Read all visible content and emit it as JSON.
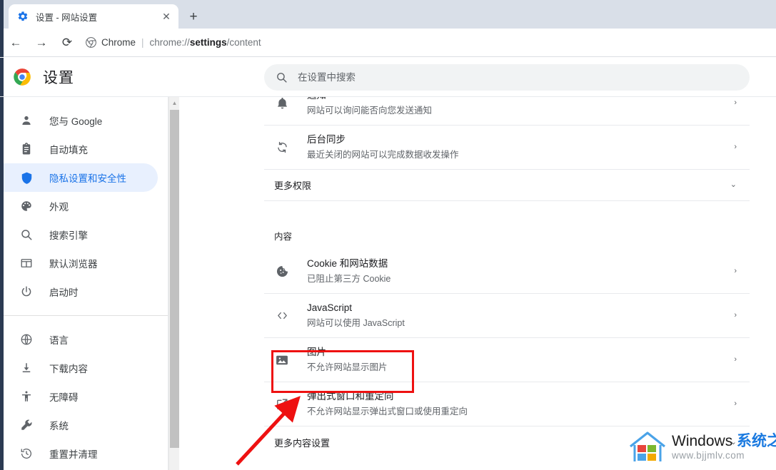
{
  "window": {
    "tab": {
      "title": "设置 - 网站设置",
      "favicon": "gear-icon",
      "close_label": "✕"
    },
    "new_tab_label": "+"
  },
  "toolbar": {
    "back_label": "←",
    "forward_label": "→",
    "reload_label": "⟳",
    "omnibox": {
      "scheme_label": "Chrome",
      "separator": "|",
      "url_prefix": "chrome://",
      "url_highlight": "settings",
      "url_suffix": "/content",
      "full_url": "chrome://settings/content"
    }
  },
  "settings_header": {
    "title": "设置",
    "search": {
      "placeholder": "在设置中搜索",
      "value": ""
    }
  },
  "sidebar": {
    "group1": [
      {
        "icon": "person-icon",
        "label": "您与 Google",
        "active": false
      },
      {
        "icon": "autofill-icon",
        "label": "自动填充",
        "active": false
      },
      {
        "icon": "shield-icon",
        "label": "隐私设置和安全性",
        "active": true
      },
      {
        "icon": "palette-icon",
        "label": "外观",
        "active": false
      },
      {
        "icon": "search-icon",
        "label": "搜索引擎",
        "active": false
      },
      {
        "icon": "browser-icon",
        "label": "默认浏览器",
        "active": false
      },
      {
        "icon": "power-icon",
        "label": "启动时",
        "active": false
      }
    ],
    "group2": [
      {
        "icon": "globe-icon",
        "label": "语言",
        "active": false
      },
      {
        "icon": "download-icon",
        "label": "下载内容",
        "active": false
      },
      {
        "icon": "accessibility-icon",
        "label": "无障碍",
        "active": false
      },
      {
        "icon": "wrench-icon",
        "label": "系统",
        "active": false
      },
      {
        "icon": "restore-icon",
        "label": "重置并清理",
        "active": false
      }
    ]
  },
  "main": {
    "permission_rows": [
      {
        "icon": "bell-icon",
        "title": "通知",
        "subtitle": "网站可以询问能否向您发送通知",
        "chevron": "›"
      },
      {
        "icon": "sync-icon",
        "title": "后台同步",
        "subtitle": "最近关闭的网站可以完成数据收发操作",
        "chevron": "›"
      }
    ],
    "more_permissions": {
      "label": "更多权限",
      "chevron": "⌄"
    },
    "content_section_label": "内容",
    "content_rows": [
      {
        "icon": "cookie-icon",
        "title": "Cookie 和网站数据",
        "subtitle": "已阻止第三方 Cookie",
        "chevron": "›",
        "highlighted": false
      },
      {
        "icon": "code-icon",
        "title": "JavaScript",
        "subtitle": "网站可以使用 JavaScript",
        "chevron": "›",
        "highlighted": false
      },
      {
        "icon": "image-icon",
        "title": "图片",
        "subtitle": "不允许网站显示图片",
        "chevron": "›",
        "highlighted": true
      },
      {
        "icon": "popup-icon",
        "title": "弹出式窗口和重定向",
        "subtitle": "不允许网站显示弹出式窗口或使用重定向",
        "chevron": "›",
        "highlighted": false
      }
    ],
    "more_content_settings": {
      "label": "更多内容设置",
      "chevron": "⌄"
    }
  },
  "annotations": {
    "highlight_color": "#ee1111",
    "box_target": "图片",
    "arrow_target": "弹出式窗口和重定向"
  },
  "watermark": {
    "brand_en": "Windows ",
    "brand_cn": "系统之家",
    "url": "www.bjjmlv.com",
    "logo": "windows-house-logo"
  }
}
